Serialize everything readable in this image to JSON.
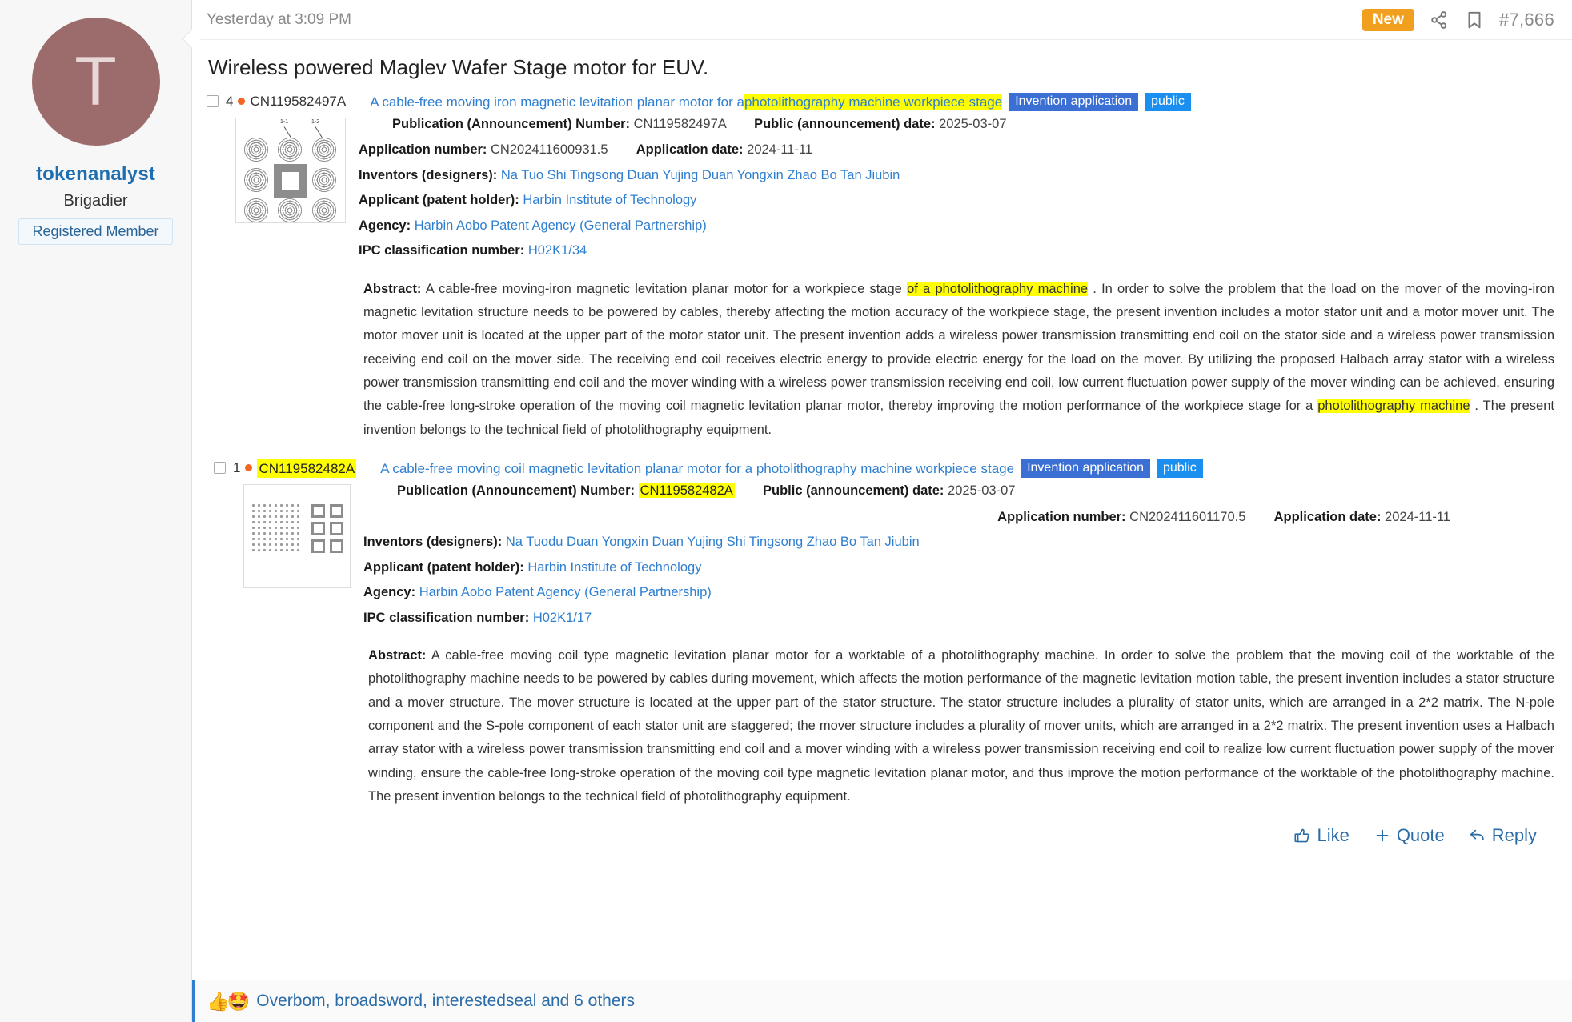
{
  "user": {
    "avatar_letter": "T",
    "username": "tokenanalyst",
    "title": "Brigadier",
    "banner": "Registered Member"
  },
  "post_header": {
    "date": "Yesterday at 3:09 PM",
    "new_badge": "New",
    "share_icon": "share-icon",
    "bookmark_icon": "bookmark-icon",
    "post_number": "#7,666"
  },
  "thread": {
    "title": "Wireless powered Maglev Wafer Stage motor for EUV."
  },
  "entries": [
    {
      "rank": "4",
      "patent_number": "CN119582497A",
      "patent_number_highlighted": false,
      "title_pre": "A cable-free moving iron magnetic levitation planar motor for a ",
      "title_highlight": "photolithography machine workpiece stage",
      "badge_kind": "Invention application",
      "badge_status": "public",
      "pub_label": "Publication (Announcement) Number:",
      "pub_value": "CN119582497A",
      "pubdate_label": "Public (announcement) date:",
      "pubdate_value": "2025-03-07",
      "appnum_label": "Application number:",
      "appnum_value": "CN202411600931.5",
      "appdate_label": "Application date:",
      "appdate_value": "2024-11-11",
      "inventors_label": "Inventors (designers):",
      "inventors_value": "Na Tuo Shi Tingsong Duan Yujing Duan Yongxin Zhao Bo Tan Jiubin",
      "applicant_label": "Applicant (patent holder):",
      "applicant_value": "Harbin Institute of Technology",
      "agency_label": "Agency:",
      "agency_value": "Harbin Aobo Patent Agency (General Partnership)",
      "ipc_label": "IPC classification number:",
      "ipc_value": "H02K1/34",
      "abstract_label": "Abstract:",
      "abstract_part1": "A cable-free moving-iron magnetic levitation planar motor for a workpiece stage ",
      "abstract_mark1": "of a photolithography machine",
      "abstract_part2": " . In order to solve the problem that the load on the mover of the moving-iron magnetic levitation structure needs to be powered by cables, thereby affecting the motion accuracy of the workpiece stage, the present invention includes a motor stator unit and a motor mover unit. The motor mover unit is located at the upper part of the motor stator unit. The present invention adds a wireless power transmission transmitting end coil on the stator side and a wireless power transmission receiving end coil on the mover side. The receiving end coil receives electric energy to provide electric energy for the load on the mover. By utilizing the proposed Halbach array stator with a wireless power transmission transmitting end coil and the mover winding with a wireless power transmission receiving end coil, low current fluctuation power supply of the mover winding can be achieved, ensuring the cable-free long-stroke operation of the moving coil magnetic levitation planar motor, thereby improving the motion performance of the workpiece stage for a ",
      "abstract_mark2": "photolithography machine",
      "abstract_part3": " . The present invention belongs to the technical field of photolithography equipment."
    },
    {
      "rank": "1",
      "patent_number": "CN119582482A",
      "patent_number_highlighted": true,
      "title_pre": "A cable-free moving coil magnetic levitation planar motor for a photolithography machine workpiece stage",
      "title_highlight": "",
      "badge_kind": "Invention application",
      "badge_status": "public",
      "pub_label": "Publication (Announcement) Number:",
      "pub_value": "CN119582482A",
      "pubdate_label": "Public (announcement) date:",
      "pubdate_value": "2025-03-07",
      "appnum_label": "Application number:",
      "appnum_value": "CN202411601170.5",
      "appdate_label": "Application date:",
      "appdate_value": "2024-11-11",
      "inventors_label": "Inventors (designers):",
      "inventors_value": "Na Tuodu Duan Yongxin Duan Yujing Shi Tingsong Zhao Bo Tan Jiubin",
      "applicant_label": "Applicant (patent holder):",
      "applicant_value": "Harbin Institute of Technology",
      "agency_label": "Agency:",
      "agency_value": "Harbin Aobo Patent Agency (General Partnership)",
      "ipc_label": "IPC classification number:",
      "ipc_value": "H02K1/17",
      "abstract_label": "Abstract:",
      "abstract_part1": "A cable-free moving coil type magnetic levitation planar motor for a worktable of a photolithography machine. In order to solve the problem that the moving coil of the worktable of the photolithography machine needs to be powered by cables during movement, which affects the motion performance of the magnetic levitation motion table, the present invention includes a stator structure and a mover structure. The mover structure is located at the upper part of the stator structure. The stator structure includes a plurality of stator units, which are arranged in a 2*2 matrix. The N-pole component and the S-pole component of each stator unit are staggered; the mover structure includes a plurality of mover units, which are arranged in a 2*2 matrix. The present invention uses a Halbach array stator with a wireless power transmission transmitting end coil and a mover winding with a wireless power transmission receiving end coil to realize low current fluctuation power supply of the mover winding, ensure the cable-free long-stroke operation of the moving coil type magnetic levitation planar motor, and thus improve the motion performance of the worktable of the photolithography machine. The present invention belongs to the technical field of photolithography equipment.",
      "abstract_mark1": "",
      "abstract_part2": "",
      "abstract_mark2": "",
      "abstract_part3": ""
    }
  ],
  "figure_labels": {
    "label_1_1": "1-1",
    "label_1_2": "1-2"
  },
  "actions": {
    "like": "Like",
    "quote": "Quote",
    "reply": "Reply"
  },
  "reactions": {
    "emoji_like": "👍",
    "emoji_love": "🤩",
    "text": "Overbom, broadsword, interestedseal and 6 others"
  },
  "colors": {
    "accent_blue": "#2f7fd0",
    "badge_orange": "#f0a01e",
    "highlight_yellow": "#ffff00",
    "badge_invention": "#3b6fd4",
    "badge_public": "#1a8ff0",
    "avatar_bg": "#9c6b6b"
  }
}
